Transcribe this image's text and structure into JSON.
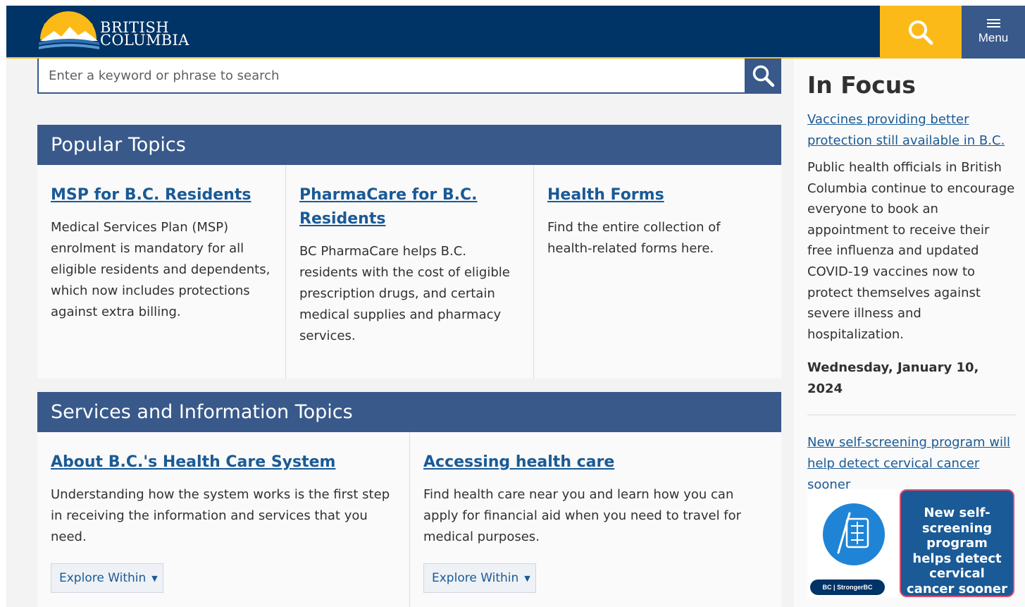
{
  "header": {
    "logo_line1": "BRITISH",
    "logo_line2": "COLUMBIA",
    "search_icon": "search-icon",
    "menu_label": "Menu",
    "menu_icon": "hamburger-icon"
  },
  "search": {
    "placeholder": "Enter a keyword or phrase to search",
    "button_icon": "search-icon"
  },
  "popular_topics": {
    "heading": "Popular Topics",
    "items": [
      {
        "title": "MSP for B.C. Residents",
        "description": "Medical Services Plan (MSP) enrolment is mandatory for all eligible residents and dependents, which now includes protections against extra billing."
      },
      {
        "title": "PharmaCare for B.C. Residents",
        "description": "BC PharmaCare helps B.C. residents with the cost of eligible prescription drugs, and certain medical supplies and pharmacy services."
      },
      {
        "title": "Health Forms",
        "description": "Find the entire collection of health-related forms here."
      }
    ]
  },
  "services_topics": {
    "heading": "Services and Information Topics",
    "items": [
      {
        "title": "About B.C.'s Health Care System",
        "description": "Understanding how the system works is the first step in receiving the information and services that you need.",
        "button": "Explore Within"
      },
      {
        "title": "Accessing health care",
        "description": "Find health care near you and learn how you can apply for financial aid when you need to travel for medical purposes.",
        "button": "Explore Within"
      }
    ]
  },
  "in_focus": {
    "heading": "In Focus",
    "story1_link": "Vaccines providing better protection still available in B.C.",
    "story1_text": "Public health officials in British Columbia continue to encourage everyone to book an appointment to receive their free influenza and updated COVID-19 vaccines now to protect themselves against severe illness and hospitalization.",
    "story1_date": "Wednesday, January 10, 2024",
    "story2_link": "New self-screening program will help detect cervical cancer sooner",
    "promo_text": "New self-screening program helps detect cervical cancer sooner",
    "promo_badge": "BC | StrongerBC"
  },
  "colors": {
    "header_bg": "#003366",
    "accent_gold": "#fcba19",
    "panel_blue": "#38598a",
    "link_blue": "#1a5a96"
  }
}
